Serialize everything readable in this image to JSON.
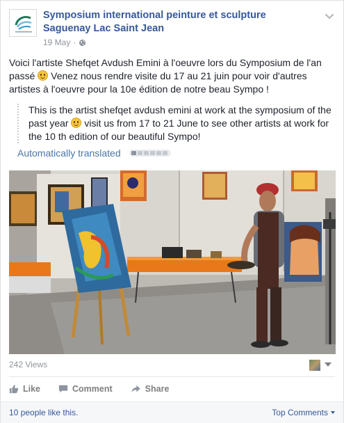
{
  "post": {
    "page_name": "Symposium international peinture et sculpture Saguenay Lac Saint Jean",
    "date": "19 May",
    "separator": "·",
    "original_text_1": "Voici l'artiste Shefqet Avdush Emini à l'oeuvre lors du Symposium de l'an passé",
    "original_text_2": "Venez nous rendre visite du 17 au 21 juin pour voir d'autres artistes à l'oeuvre pour la 10e édition de notre beau Sympo !",
    "translation_1": "This is the artist shefqet avdush emini at work at the symposium of the past year",
    "translation_2": "visit us from 17 to 21 June to see other artists at work for the 10 th edition of our beautiful Sympo!",
    "auto_translated_label": "Automatically translated",
    "views": "242 Views"
  },
  "actions": {
    "like_label": "Like",
    "comment_label": "Comment",
    "share_label": "Share"
  },
  "footer": {
    "likes_text": "10 people like this.",
    "top_comments_label": "Top Comments"
  },
  "icons": {
    "avatar": "page-logo",
    "chevron": "chevron-down-icon",
    "globe": "globe-icon",
    "like": "thumbs-up-icon",
    "comment": "speech-bubble-icon",
    "share": "share-arrow-icon"
  },
  "colors": {
    "link": "#365899",
    "muted": "#90949c",
    "translated": "#4a76a8"
  }
}
